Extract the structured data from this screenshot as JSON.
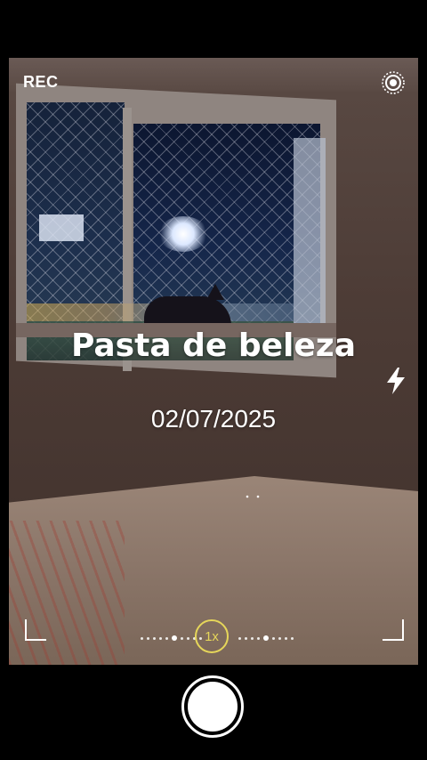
{
  "camera": {
    "record_label": "REC",
    "title_overlay": "Pasta de beleza",
    "date_overlay": "02/07/2025",
    "zoom_label": "1x"
  },
  "icons": {
    "settings": "settings-ring-icon",
    "flash": "flash-icon",
    "shutter": "shutter-button"
  },
  "colors": {
    "zoom_accent": "#e6d65a",
    "overlay_text": "#ffffff"
  }
}
